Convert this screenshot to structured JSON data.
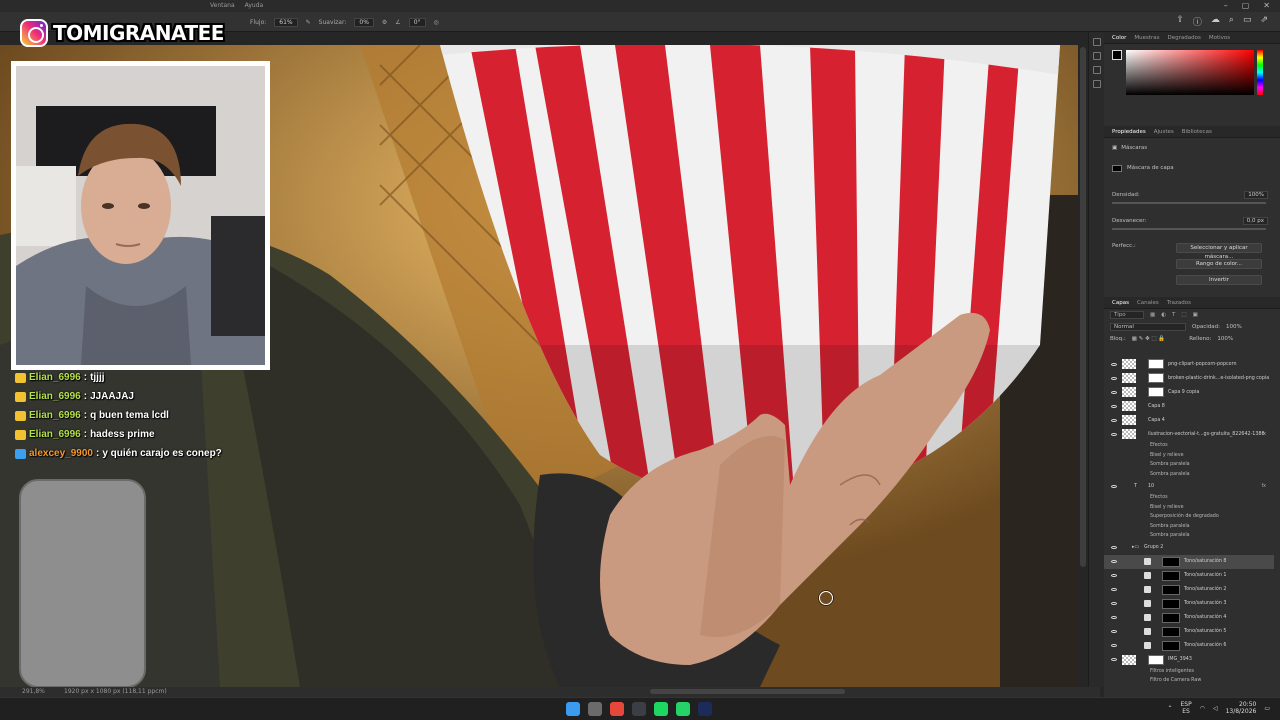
{
  "menubar": {
    "menus": [
      "Ventana",
      "Ayuda"
    ],
    "window_controls": [
      "–",
      "▢",
      "✕"
    ]
  },
  "options_bar": {
    "flow_label": "Flujo:",
    "flow_value": "61%",
    "smoothing_label": "Suavizar:",
    "smoothing_value": "0%",
    "angle_value": "0°"
  },
  "overlay": {
    "instagram_handle": "TOMIGRANATEE"
  },
  "chat": [
    {
      "user": "Elian_6996",
      "text": "tjjjj",
      "color": "#b4e04a",
      "badge": "#f2c230"
    },
    {
      "user": "Elian_6996",
      "text": "JJAAJAJ",
      "color": "#b4e04a",
      "badge": "#f2c230"
    },
    {
      "user": "Elian_6996",
      "text": "q buen tema lcdl",
      "color": "#b4e04a",
      "badge": "#f2c230"
    },
    {
      "user": "Elian_6996",
      "text": "hadess prime",
      "color": "#b4e04a",
      "badge": "#f2c230"
    },
    {
      "user": "alexcey_9900",
      "text": "y quién carajo es conep?",
      "color": "#f29a2e",
      "badge": "#3ca0f0"
    }
  ],
  "color_panel": {
    "tabs": [
      "Color",
      "Muestras",
      "Degradados",
      "Motivos"
    ]
  },
  "properties_panel": {
    "tabs": [
      "Propiedades",
      "Ajustes",
      "Bibliotecas"
    ],
    "section": "Máscaras",
    "mask_name": "Máscara de capa",
    "density_label": "Densidad:",
    "density_value": "100%",
    "density_level": 1.0,
    "feather_label": "Desvanecer:",
    "feather_value": "0,0 px",
    "feather_level": 0.0,
    "refine_label": "Perfecc.:",
    "btn_select_mask": "Seleccionar y aplicar máscara...",
    "btn_color_range": "Rango de color...",
    "btn_invert": "Invertir"
  },
  "layers_panel": {
    "tabs": [
      "Capas",
      "Canales",
      "Trazados"
    ],
    "kind_filter": "Tipo",
    "blend_mode": "Normal",
    "opacity_label": "Opacidad:",
    "opacity_value": "100%",
    "lock_label": "Bloq.:",
    "fill_label": "Relleno:",
    "fill_value": "100%",
    "layers": [
      {
        "name": "png-clipart-popcorn-popcorn",
        "type": "mask"
      },
      {
        "name": "broken-plastic-drink...e-isolated-png copia",
        "type": "mask"
      },
      {
        "name": "Capa 9 copia",
        "type": "mask"
      },
      {
        "name": "Capa 8",
        "type": "nomask"
      },
      {
        "name": "Capa 4",
        "type": "nomask"
      },
      {
        "name": "ilustracion-vectorial-t...gs-gratuita_822642-1388",
        "type": "nomask",
        "fx": "fx"
      },
      {
        "name": "Efectos",
        "type": "sub"
      },
      {
        "name": "Bisel y relieve",
        "type": "sub"
      },
      {
        "name": "Sombra paralela",
        "type": "sub"
      },
      {
        "name": "Sombra paralela",
        "type": "sub"
      },
      {
        "name": "10",
        "type": "text",
        "fx": "fx"
      },
      {
        "name": "Efectos",
        "type": "sub"
      },
      {
        "name": "Bisel y relieve",
        "type": "sub"
      },
      {
        "name": "Superposición de degradado",
        "type": "sub"
      },
      {
        "name": "Sombra paralela",
        "type": "sub"
      },
      {
        "name": "Sombra paralela",
        "type": "sub"
      },
      {
        "name": "Grupo 2",
        "type": "folder"
      },
      {
        "name": "Tono/saturación 8",
        "type": "adj",
        "selected": true
      },
      {
        "name": "Tono/saturación 1",
        "type": "adj"
      },
      {
        "name": "Tono/saturación 2",
        "type": "adj"
      },
      {
        "name": "Tono/saturación 3",
        "type": "adj"
      },
      {
        "name": "Tono/saturación 4",
        "type": "adj"
      },
      {
        "name": "Tono/saturación 5",
        "type": "adj"
      },
      {
        "name": "Tono/saturación 6",
        "type": "adj"
      },
      {
        "name": "IMG_3943",
        "type": "mask"
      },
      {
        "name": "Filtros inteligentes",
        "type": "sub"
      },
      {
        "name": "Filtro de Camera Raw",
        "type": "sub"
      }
    ]
  },
  "status_bar": {
    "zoom": "291,8%",
    "dimensions": "1920 px x 1080 px (118,11 ppcm)"
  },
  "taskbar": {
    "lang_top": "ESP",
    "lang_bottom": "ES",
    "time": "20:50",
    "date": "13/8/2026",
    "apps": [
      {
        "name": "windows-start",
        "color": "#3a9bf0"
      },
      {
        "name": "settings",
        "color": "#6b6b6b"
      },
      {
        "name": "chrome",
        "color": "#e5483b"
      },
      {
        "name": "steam",
        "color": "#3a3f46"
      },
      {
        "name": "spotify",
        "color": "#1ed760"
      },
      {
        "name": "whatsapp",
        "color": "#25d366"
      },
      {
        "name": "photoshop",
        "color": "#1c2b5a"
      }
    ]
  }
}
